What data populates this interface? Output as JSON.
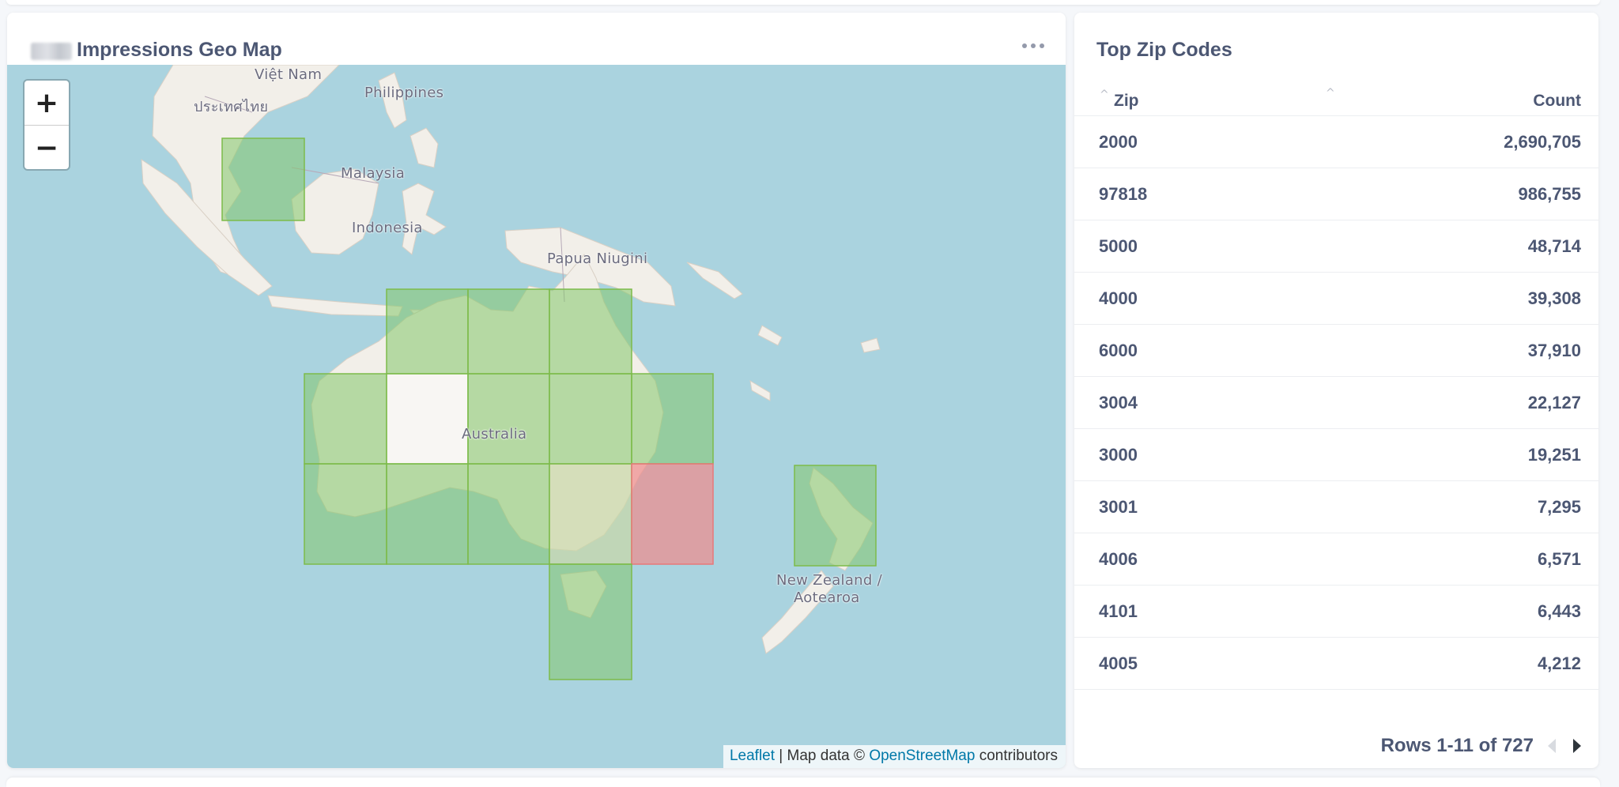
{
  "map_card": {
    "title": "Impressions Geo Map",
    "zoom_in": "+",
    "zoom_out": "−",
    "labels": {
      "vietnam": "Việt Nam",
      "thailand": "ประเทศไทย",
      "philippines": "Philippines",
      "malaysia": "Malaysia",
      "indonesia": "Indonesia",
      "png": "Papua Niugini",
      "australia": "Australia",
      "nz1": "New Zealand /",
      "nz2": "Aotearoa"
    },
    "attribution": {
      "leaflet": "Leaflet",
      "sep": " | Map data © ",
      "osm": "OpenStreetMap",
      "tail": " contributors"
    },
    "colors": {
      "water": "#aad3df",
      "land": "#f2efe9",
      "green_cell": "#84c66a",
      "red_cell": "#f08a8a"
    }
  },
  "zip_card": {
    "title": "Top Zip Codes",
    "columns": {
      "zip": "Zip",
      "count": "Count"
    },
    "rows": [
      {
        "zip": "2000",
        "count": "2,690,705"
      },
      {
        "zip": "97818",
        "count": "986,755"
      },
      {
        "zip": "5000",
        "count": "48,714"
      },
      {
        "zip": "4000",
        "count": "39,308"
      },
      {
        "zip": "6000",
        "count": "37,910"
      },
      {
        "zip": "3004",
        "count": "22,127"
      },
      {
        "zip": "3000",
        "count": "19,251"
      },
      {
        "zip": "3001",
        "count": "7,295"
      },
      {
        "zip": "4006",
        "count": "6,571"
      },
      {
        "zip": "4101",
        "count": "6,443"
      },
      {
        "zip": "4005",
        "count": "4,212"
      }
    ],
    "pager": "Rows 1-11 of 727"
  }
}
